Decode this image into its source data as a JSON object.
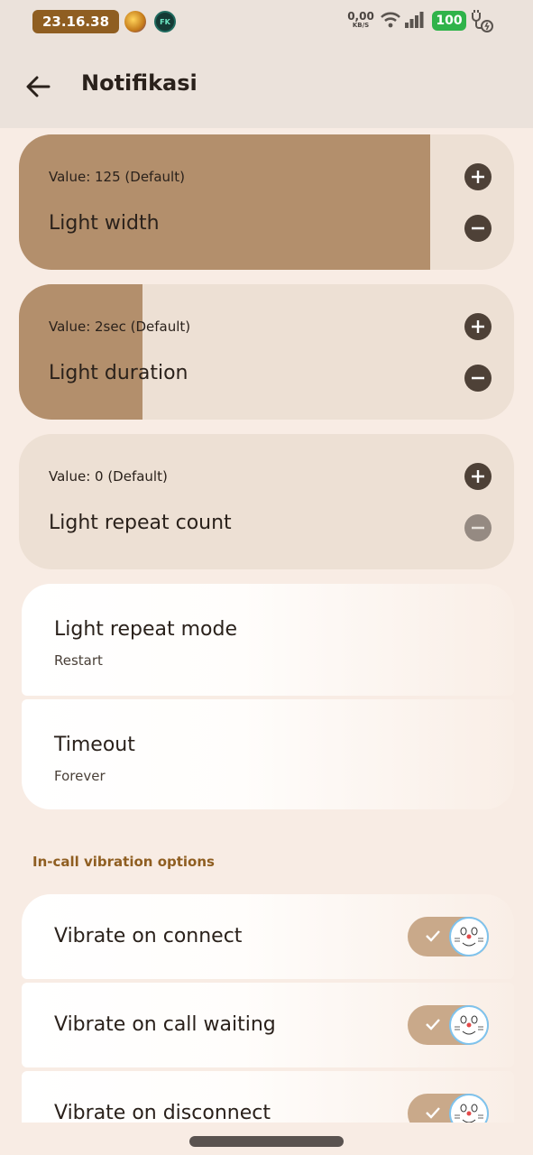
{
  "status_bar": {
    "time": "23.16.38",
    "app_icon_2_label": "FK",
    "net_speed_value": "0,00",
    "net_speed_unit": "KB/S",
    "battery": "100"
  },
  "app_bar": {
    "title": "Notifikasi"
  },
  "seek_settings": [
    {
      "value_text": "Value: 125 (Default)",
      "title": "Light width",
      "fill_fraction": 0.83,
      "minus_enabled": true
    },
    {
      "value_text": "Value: 2sec (Default)",
      "title": "Light duration",
      "fill_fraction": 0.25,
      "minus_enabled": true
    },
    {
      "value_text": "Value: 0 (Default)",
      "title": "Light repeat count",
      "fill_fraction": 0.0,
      "minus_enabled": false
    }
  ],
  "list_items": [
    {
      "title": "Light repeat mode",
      "summary": "Restart"
    },
    {
      "title": "Timeout",
      "summary": "Forever"
    }
  ],
  "section_header": "In-call vibration options",
  "toggles": [
    {
      "title": "Vibrate on connect",
      "checked": true
    },
    {
      "title": "Vibrate on call waiting",
      "checked": true
    },
    {
      "title": "Vibrate on disconnect",
      "checked": true
    }
  ],
  "colors": {
    "accent": "#8f5e21",
    "seek_fill": "#b38f6c",
    "seek_track": "#ede0d4",
    "toggle_track": "#c9a98a"
  },
  "icons": {
    "back": "arrow-left-icon",
    "plus": "plus-icon",
    "minus": "minus-icon",
    "toggle_thumb": "cat-face-icon"
  }
}
